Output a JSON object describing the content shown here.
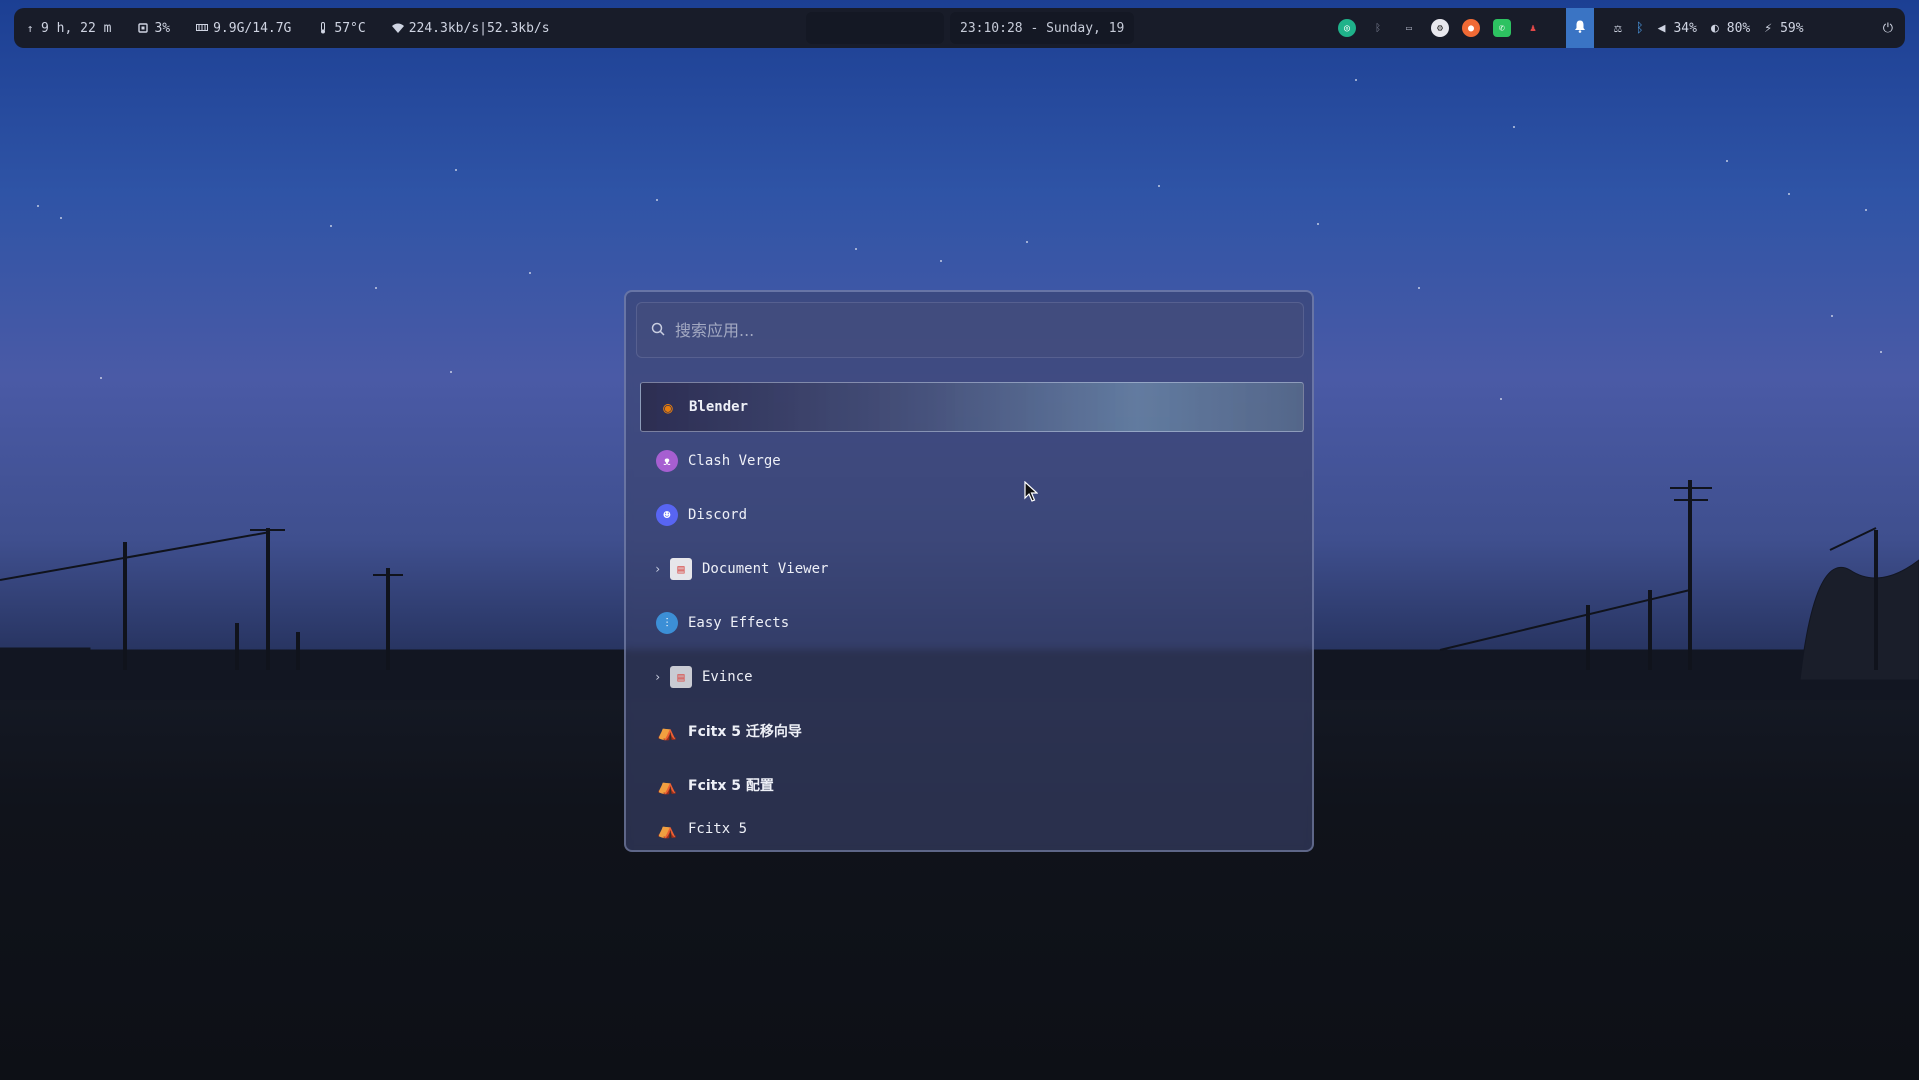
{
  "topbar": {
    "uptime": "9 h, 22 m",
    "cpu": "3%",
    "memory": "9.9G/14.7G",
    "temperature": "57°C",
    "network": "224.3kb/s|52.3kb/s",
    "clock": "23:10:28 - Sunday, 19",
    "volume": "34%",
    "brightness": "80%",
    "battery": "59%"
  },
  "launcher": {
    "search_placeholder": "搜索应用...",
    "items": [
      {
        "label": "Blender",
        "icon": "blender-icon",
        "color": "#e87d0d",
        "expandable": false,
        "selected": true
      },
      {
        "label": "Clash Verge",
        "icon": "clash-verge-icon",
        "color": "#a65fd1",
        "expandable": false
      },
      {
        "label": "Discord",
        "icon": "discord-icon",
        "color": "#5865f2",
        "expandable": false
      },
      {
        "label": "Document Viewer",
        "icon": "document-viewer-icon",
        "color": "#d9534f",
        "expandable": true
      },
      {
        "label": "Easy Effects",
        "icon": "easy-effects-icon",
        "color": "#3c8fd6",
        "expandable": false
      },
      {
        "label": "Evince",
        "icon": "evince-icon",
        "color": "#c9cbd3",
        "expandable": true
      },
      {
        "label": "Fcitx 5 迁移向导",
        "icon": "fcitx-icon",
        "color": "#e9b65c",
        "expandable": false
      },
      {
        "label": "Fcitx 5 配置",
        "icon": "fcitx-icon",
        "color": "#e9b65c",
        "expandable": false
      },
      {
        "label": "Fcitx 5",
        "icon": "fcitx-icon",
        "color": "#e9b65c",
        "expandable": false
      }
    ]
  },
  "colors": {
    "bar_bg": "#181c29",
    "accent": "#3a74c4"
  }
}
